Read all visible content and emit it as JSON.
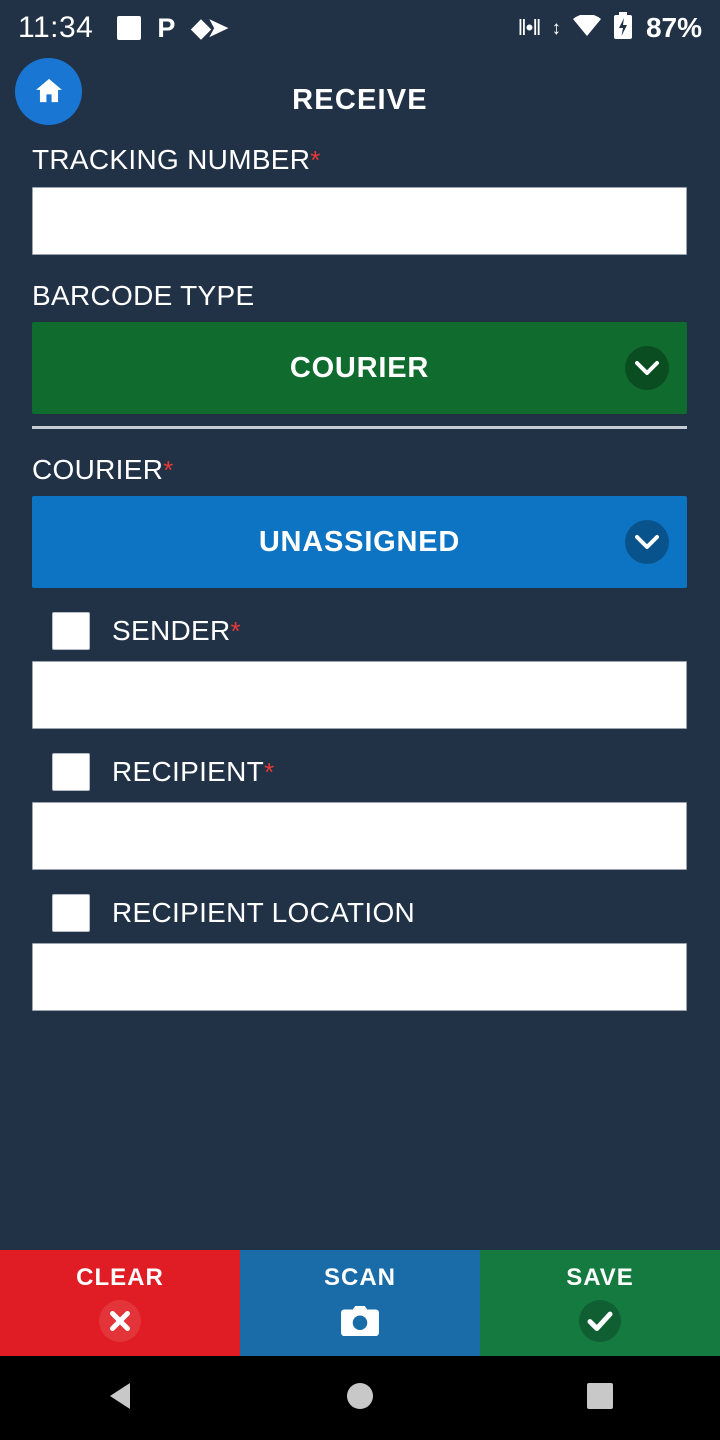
{
  "status_bar": {
    "time": "11:34",
    "battery_percent": "87%",
    "icons": [
      "square-icon",
      "p-icon",
      "diamond-arrow-icon",
      "vibrate-icon",
      "data-transfer-icon",
      "wifi-icon",
      "battery-charging-icon"
    ]
  },
  "header": {
    "title": "RECEIVE",
    "home_icon": "home-icon"
  },
  "form": {
    "tracking": {
      "label": "TRACKING NUMBER",
      "required": "*",
      "value": "",
      "placeholder": ""
    },
    "barcode_type": {
      "label": "BARCODE TYPE",
      "selected": "COURIER",
      "color": "#0f6b2e"
    },
    "courier": {
      "label": "COURIER",
      "required": "*",
      "selected": "UNASSIGNED",
      "color": "#0d74c4"
    },
    "sender": {
      "label": "SENDER",
      "required": "*",
      "value": "",
      "checked": false
    },
    "recipient": {
      "label": "RECIPIENT",
      "required": "*",
      "value": "",
      "checked": false
    },
    "recipient_location": {
      "label": "RECIPIENT LOCATION",
      "required": "",
      "value": "",
      "checked": false
    }
  },
  "actions": {
    "clear": {
      "label": "CLEAR",
      "icon": "close-circle-icon",
      "color": "#e01d24"
    },
    "scan": {
      "label": "SCAN",
      "icon": "camera-icon",
      "color": "#1a6ca8"
    },
    "save": {
      "label": "SAVE",
      "icon": "check-circle-icon",
      "color": "#147a40"
    }
  },
  "navbar": {
    "back": "back-triangle-icon",
    "home": "home-circle-icon",
    "recents": "recents-square-icon"
  }
}
